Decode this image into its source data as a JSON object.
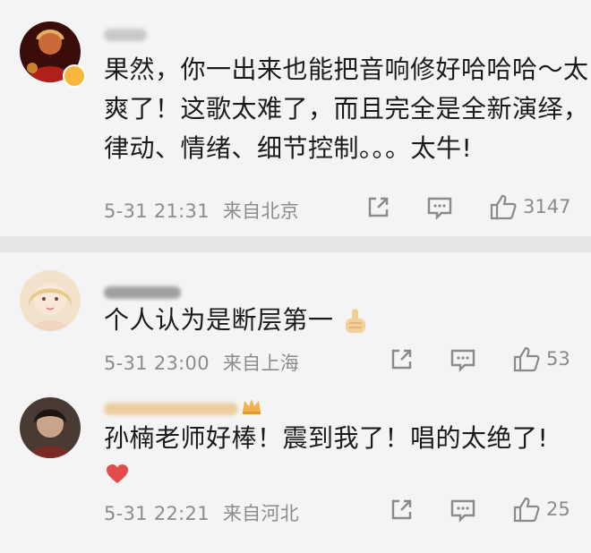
{
  "comments": [
    {
      "text_line1": "果然，你一出来也能把音响修好哈哈哈～太",
      "text_line2": "爽了！这歌太难了，而且完全是全新演绎，",
      "text_line3": "律动、情绪、细节控制。。。太牛!",
      "time": "5-31 21:31",
      "location": "来自北京",
      "likes": "3147"
    },
    {
      "text": "个人认为是断层第一",
      "time": "5-31 23:00",
      "location": "来自上海",
      "likes": "53"
    },
    {
      "text": "孙楠老师好棒！震到我了！唱的太绝了!",
      "time": "5-31 22:21",
      "location": "来自河北",
      "likes": "25"
    }
  ],
  "colors": {
    "background": "#f4f4f4",
    "separator": "#e7e7e7",
    "meta_text": "#8c8c8c",
    "badge": "#f6b73c",
    "heart": "#e24b4b"
  }
}
